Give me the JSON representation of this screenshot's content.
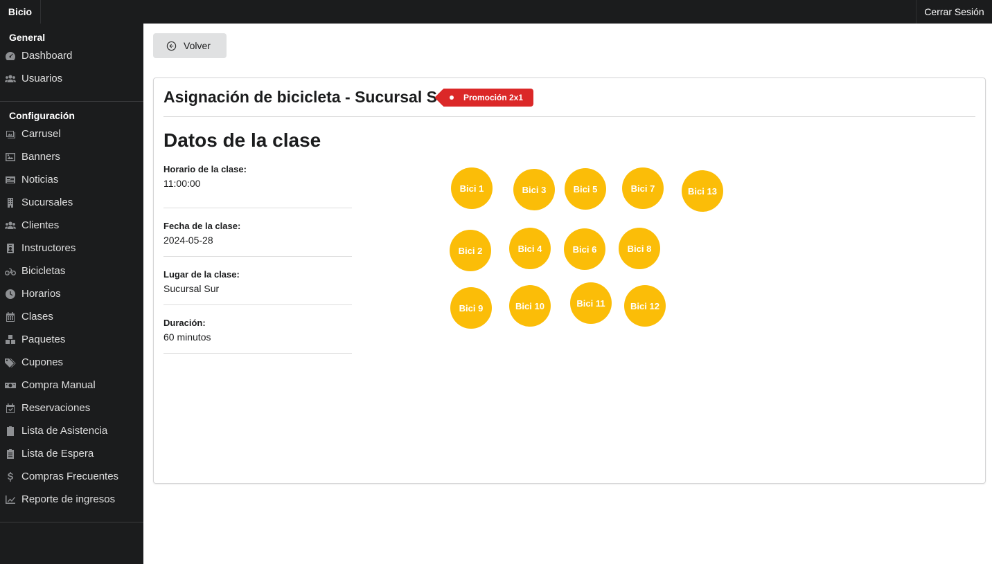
{
  "topbar": {
    "brand": "Bicio",
    "logout": "Cerrar Sesión"
  },
  "sidebar": {
    "sections": [
      {
        "title": "General",
        "items": [
          {
            "label": "Dashboard",
            "icon": "dashboard-icon"
          },
          {
            "label": "Usuarios",
            "icon": "users-icon"
          }
        ]
      },
      {
        "title": "Configuración",
        "items": [
          {
            "label": "Carrusel",
            "icon": "images-icon"
          },
          {
            "label": "Banners",
            "icon": "image-icon"
          },
          {
            "label": "Noticias",
            "icon": "newspaper-icon"
          },
          {
            "label": "Sucursales",
            "icon": "building-icon"
          },
          {
            "label": "Clientes",
            "icon": "users-icon"
          },
          {
            "label": "Instructores",
            "icon": "id-badge-icon"
          },
          {
            "label": "Bicicletas",
            "icon": "bicycle-icon"
          },
          {
            "label": "Horarios",
            "icon": "clock-icon"
          },
          {
            "label": "Clases",
            "icon": "calendar-icon"
          },
          {
            "label": "Paquetes",
            "icon": "cubes-icon"
          },
          {
            "label": "Cupones",
            "icon": "tags-icon"
          },
          {
            "label": "Compra Manual",
            "icon": "money-icon"
          },
          {
            "label": "Reservaciones",
            "icon": "calendar-check-icon"
          },
          {
            "label": "Lista de Asistencia",
            "icon": "clipboard-check-icon"
          },
          {
            "label": "Lista de Espera",
            "icon": "clipboard-list-icon"
          },
          {
            "label": "Compras Frecuentes",
            "icon": "dollar-icon"
          },
          {
            "label": "Reporte de ingresos",
            "icon": "chart-line-icon"
          }
        ]
      }
    ]
  },
  "back_button": {
    "label": "Volver",
    "icon": "arrow-circle-left-icon"
  },
  "card": {
    "title": "Asignación de bicicleta - Sucursal Sur",
    "tag": "Promoción 2x1",
    "tag_color": "#db2828",
    "section_heading": "Datos de la clase",
    "info": [
      {
        "label": "Horario de la clase:",
        "value": "11:00:00"
      },
      {
        "label": "Fecha de la clase:",
        "value": "2024-05-28"
      },
      {
        "label": "Lugar de la clase:",
        "value": "Sucursal Sur"
      },
      {
        "label": "Duración:",
        "value": "60 minutos"
      }
    ]
  },
  "bikes": {
    "color": "#fbbd08",
    "labels": [
      "Bici 1",
      "Bici 3",
      "Bici 5",
      "Bici 7",
      "Bici 13",
      "Bici 2",
      "Bici 4",
      "Bici 6",
      "Bici 8",
      "Bici 9",
      "Bici 10",
      "Bici 11",
      "Bici 12"
    ]
  }
}
